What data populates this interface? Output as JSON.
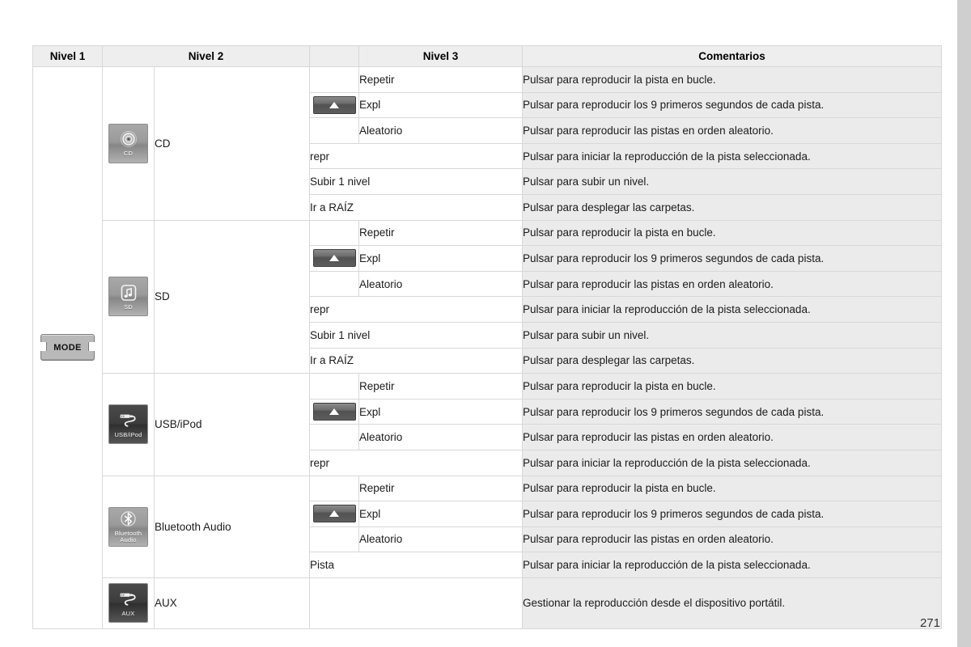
{
  "page": {
    "number": "271",
    "right_strip_color": "#cfcfcf"
  },
  "table": {
    "headers": {
      "level1": "Nivel 1",
      "level2": "Nivel 2",
      "spacer": "",
      "level3": "Nivel 3",
      "comments": "Comentarios"
    },
    "level1": {
      "key_label": "MODE",
      "icon": "mode-hard-key"
    },
    "groups": [
      {
        "id": "cd",
        "icon": "cd-disc-icon",
        "icon_label": "CD",
        "icon_style": "light",
        "name": "CD",
        "rows": [
          {
            "arrow": false,
            "level3": "Repetir",
            "comment": "Pulsar para reproducir la pista en bucle."
          },
          {
            "arrow": true,
            "level3": "Expl",
            "comment": "Pulsar para reproducir los 9 primeros segundos de cada pista."
          },
          {
            "arrow": false,
            "level3": "Aleatorio",
            "comment": "Pulsar para reproducir las pistas en orden aleatorio."
          },
          {
            "wide": true,
            "level3": "repr",
            "comment": "Pulsar para iniciar la reproducción de la pista seleccionada."
          },
          {
            "wide": true,
            "level3": "Subir 1 nivel",
            "comment": "Pulsar para subir un nivel."
          },
          {
            "wide": true,
            "level3": "Ir a RAÍZ",
            "comment": "Pulsar para desplegar las carpetas."
          }
        ]
      },
      {
        "id": "sd",
        "icon": "sd-music-note-icon",
        "icon_label": "SD",
        "icon_style": "light",
        "name": "SD",
        "rows": [
          {
            "arrow": false,
            "level3": "Repetir",
            "comment": "Pulsar para reproducir la pista en bucle."
          },
          {
            "arrow": true,
            "level3": "Expl",
            "comment": "Pulsar para reproducir los 9 primeros segundos de cada pista."
          },
          {
            "arrow": false,
            "level3": "Aleatorio",
            "comment": "Pulsar para reproducir las pistas en orden aleatorio."
          },
          {
            "wide": true,
            "level3": "repr",
            "comment": "Pulsar para iniciar la reproducción de la pista seleccionada."
          },
          {
            "wide": true,
            "level3": "Subir 1 nivel",
            "comment": "Pulsar para subir un nivel."
          },
          {
            "wide": true,
            "level3": "Ir a RAÍZ",
            "comment": "Pulsar para desplegar las carpetas."
          }
        ]
      },
      {
        "id": "usb-ipod",
        "icon": "usb-cable-icon",
        "icon_label": "USB/iPod",
        "icon_style": "dark",
        "name": "USB/iPod",
        "rows": [
          {
            "arrow": false,
            "level3": "Repetir",
            "comment": "Pulsar para reproducir la pista en bucle."
          },
          {
            "arrow": true,
            "level3": "Expl",
            "comment": "Pulsar para reproducir los 9 primeros segundos de cada pista."
          },
          {
            "arrow": false,
            "level3": "Aleatorio",
            "comment": "Pulsar para reproducir las pistas en orden aleatorio."
          },
          {
            "wide": true,
            "level3": "repr",
            "comment": "Pulsar para iniciar la reproducción de la pista seleccionada."
          }
        ]
      },
      {
        "id": "bluetooth-audio",
        "icon": "bluetooth-icon",
        "icon_label": "Bluetooth\nAudio",
        "icon_style": "light",
        "name": "Bluetooth Audio",
        "rows": [
          {
            "arrow": false,
            "level3": "Repetir",
            "comment": "Pulsar para reproducir la pista en bucle."
          },
          {
            "arrow": true,
            "level3": "Expl",
            "comment": "Pulsar para reproducir los 9 primeros segundos de cada pista."
          },
          {
            "arrow": false,
            "level3": "Aleatorio",
            "comment": "Pulsar para reproducir las pistas en orden aleatorio."
          },
          {
            "wide": true,
            "level3": "Pista",
            "comment": "Pulsar para iniciar la reproducción de la pista seleccionada."
          }
        ]
      },
      {
        "id": "aux",
        "icon": "aux-cable-icon",
        "icon_label": "AUX",
        "icon_style": "dark",
        "name": "AUX",
        "rows": [
          {
            "wide": true,
            "level3": "",
            "comment": "Gestionar la reproducción desde el dispositivo portátil."
          }
        ]
      }
    ]
  }
}
